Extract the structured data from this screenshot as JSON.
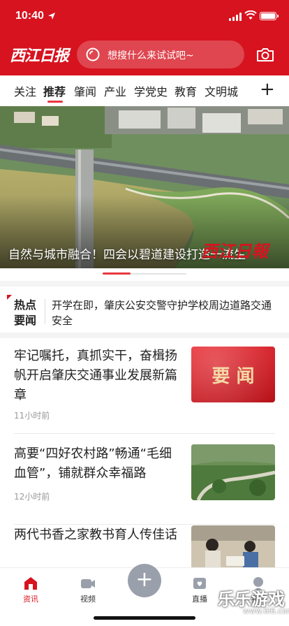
{
  "status": {
    "time": "10:40",
    "location_icon": "location-arrow-icon"
  },
  "header": {
    "logo": "西江日报",
    "search_placeholder": "想搜什么来试试吧~",
    "search_icon": "search-icon",
    "camera_icon": "camera-icon"
  },
  "channels": [
    "关注",
    "推荐",
    "肇闻",
    "产业",
    "学党史",
    "教育",
    "文明城"
  ],
  "active_channel": "推荐",
  "hero": {
    "caption": "自然与城市融合！四会以碧道建设打造一流生",
    "stamp": "西江日報"
  },
  "hot": {
    "label": "热点要闻",
    "text": "开学在即，肇庆公安交警守护学校周边道路交通安全"
  },
  "articles": [
    {
      "title": "牢记嘱托，真抓实干，奋楫扬帆开启肇庆交通事业发展新篇章",
      "time": "11小时前",
      "thumb_text": "要 闻"
    },
    {
      "title": "高要“四好农村路”畅通“毛细血管”，铺就群众幸福路",
      "time": "12小时前"
    },
    {
      "title": "两代书香之家教书育人传佳话"
    }
  ],
  "tabbar": {
    "items": [
      {
        "label": "资讯",
        "icon": "news-icon"
      },
      {
        "label": "视频",
        "icon": "video-icon"
      },
      {
        "label": "直播",
        "icon": "live-icon"
      },
      {
        "label": "我的",
        "icon": "profile-icon"
      }
    ],
    "center_icon": "add-icon"
  },
  "watermark": {
    "main": "乐乐游戏",
    "sub": "www.6l6.com"
  },
  "colors": {
    "brand": "#d7131f",
    "accent": "#e8383d"
  }
}
